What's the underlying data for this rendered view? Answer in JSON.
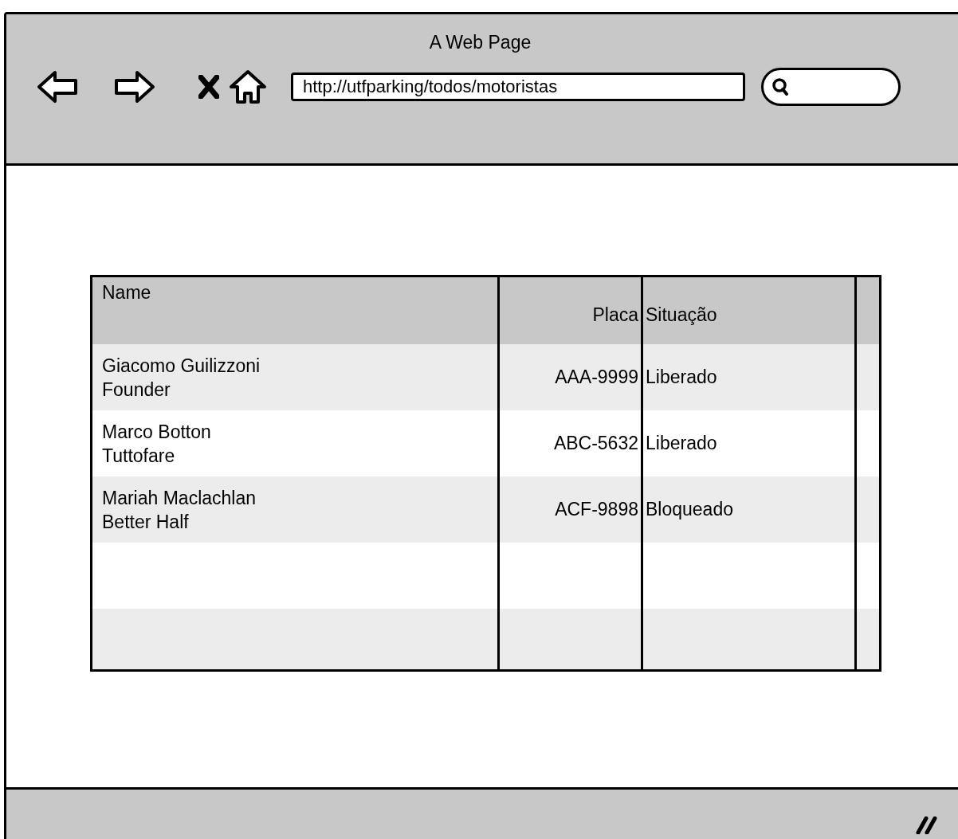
{
  "window": {
    "title": "A Web Page"
  },
  "address_bar": {
    "url": "http://utfparking/todos/motoristas"
  },
  "table": {
    "columns": [
      "Name",
      "Placa",
      "Situação"
    ],
    "rows": [
      {
        "name": "Giacomo Guilizzoni",
        "role": "Founder",
        "placa": "AAA-9999",
        "situacao": "Liberado"
      },
      {
        "name": "Marco Botton",
        "role": "Tuttofare",
        "placa": "ABC-5632",
        "situacao": "Liberado"
      },
      {
        "name": "Mariah Maclachlan",
        "role": "Better Half",
        "placa": "ACF-9898",
        "situacao": "Bloqueado"
      }
    ]
  }
}
